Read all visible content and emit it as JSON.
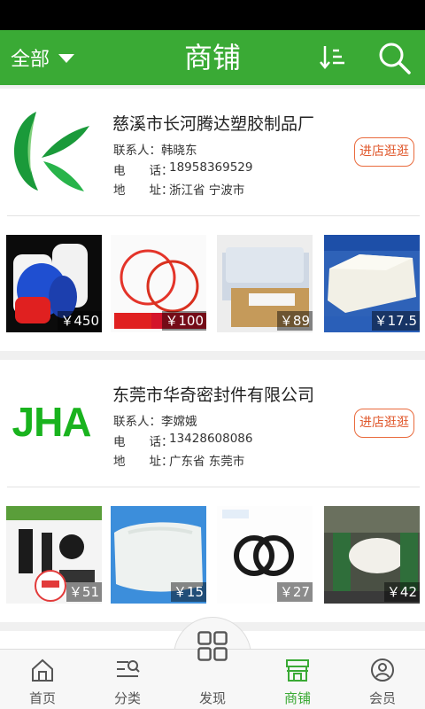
{
  "header": {
    "filter_label": "全部",
    "title": "商铺",
    "icons": [
      "chevron-down-icon",
      "sort-icon",
      "search-icon"
    ]
  },
  "shops": [
    {
      "name": "慈溪市长河腾达塑胶制品厂",
      "logo_icon": "green-k-logo",
      "contact_label": "联系人：",
      "contact": "韩晓东",
      "phone_label": "电　　话：",
      "phone": "18958369529",
      "address_label": "地　　址：",
      "address": "浙江省 宁波市",
      "visit_label": "进店逛逛",
      "products": [
        {
          "price": "￥450",
          "image": "blue-white-plastic-bottles"
        },
        {
          "price": "￥100",
          "image": "red-silicone-o-rings"
        },
        {
          "price": "￥89",
          "image": "silicone-rubber-box"
        },
        {
          "price": "￥17.5",
          "image": "white-silicone-block"
        }
      ]
    },
    {
      "name": "东莞市华奇密封件有限公司",
      "logo_text": "JHA",
      "contact_label": "联系人：",
      "contact": "李嫦娥",
      "phone_label": "电　　话：",
      "phone": "13428608086",
      "address_label": "地　　址：",
      "address": "广东省 东莞市",
      "visit_label": "进店逛逛",
      "products": [
        {
          "price": "￥51",
          "image": "black-rubber-parts"
        },
        {
          "price": "￥15",
          "image": "white-silicone-block"
        },
        {
          "price": "￥27",
          "image": "black-o-rings"
        },
        {
          "price": "￥42",
          "image": "rubber-mixing-machine"
        }
      ]
    }
  ],
  "tabbar": {
    "items": [
      {
        "label": "首页",
        "icon": "home-icon"
      },
      {
        "label": "分类",
        "icon": "category-search-icon"
      },
      {
        "label": "发现",
        "icon": "grid-icon"
      },
      {
        "label": "商铺",
        "icon": "shop-icon",
        "active": true
      },
      {
        "label": "会员",
        "icon": "user-icon"
      }
    ]
  },
  "colors": {
    "brand_green": "#3aaa35",
    "visit_button": "#e96a3c"
  }
}
